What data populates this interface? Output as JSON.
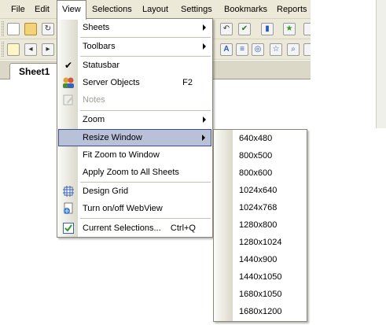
{
  "menubar": {
    "items": [
      {
        "label": "File"
      },
      {
        "label": "Edit"
      },
      {
        "label": "View"
      },
      {
        "label": "Selections"
      },
      {
        "label": "Layout"
      },
      {
        "label": "Settings"
      },
      {
        "label": "Bookmarks"
      },
      {
        "label": "Reports"
      }
    ]
  },
  "sheet_tab": {
    "label": "Sheet1"
  },
  "view_menu": {
    "items": [
      {
        "label": "Sheets"
      },
      {
        "label": "Toolbars"
      },
      {
        "label": "Statusbar"
      },
      {
        "label": "Server Objects",
        "shortcut": "F2"
      },
      {
        "label": "Notes"
      },
      {
        "label": "Zoom"
      },
      {
        "label": "Resize Window"
      },
      {
        "label": "Fit Zoom to Window"
      },
      {
        "label": "Apply Zoom to All Sheets"
      },
      {
        "label": "Design Grid"
      },
      {
        "label": "Turn on/off WebView"
      },
      {
        "label": "Current Selections...",
        "shortcut": "Ctrl+Q"
      }
    ]
  },
  "resize_submenu": {
    "items": [
      {
        "label": "640x480"
      },
      {
        "label": "800x500"
      },
      {
        "label": "800x600"
      },
      {
        "label": "1024x640"
      },
      {
        "label": "1024x768"
      },
      {
        "label": "1280x800"
      },
      {
        "label": "1280x1024"
      },
      {
        "label": "1440x900"
      },
      {
        "label": "1440x1050"
      },
      {
        "label": "1680x1050"
      },
      {
        "label": "1680x1200"
      }
    ]
  },
  "colors": {
    "highlight": "#b9c1d9",
    "highlight_border": "#3a4f8a",
    "chrome": "#ece9d8"
  }
}
